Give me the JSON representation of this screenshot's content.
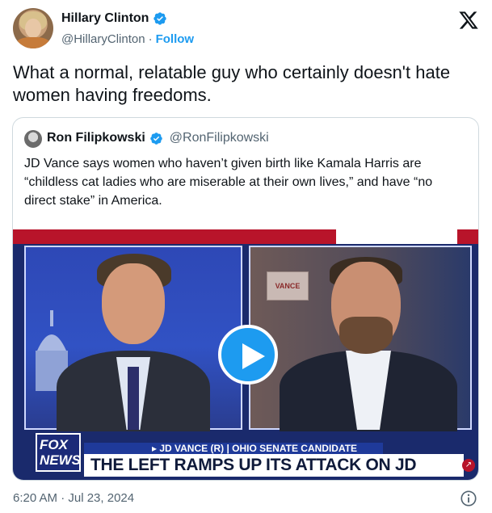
{
  "author": {
    "display_name": "Hillary Clinton",
    "handle": "@HillaryClinton",
    "separator": "·",
    "follow_label": "Follow",
    "verified_icon": "verified-badge-icon"
  },
  "brand_icon": "x-logo-icon",
  "tweet": {
    "text": "What a normal, relatable guy who certainly doesn't hate women having freedoms."
  },
  "quote": {
    "display_name": "Ron Filipkowski",
    "handle": "@RonFilipkowski",
    "text": "JD Vance says women who haven’t given birth like Kamala Harris are “childless cat ladies who are miserable at their own lives,” and have “no direct stake” in America.",
    "video": {
      "lower_third_top": "▸ JD VANCE (R) | OHIO SENATE CANDIDATE",
      "lower_third_main": "THE LEFT RAMPS UP ITS ATTACK ON JD VANCE",
      "logo_line1": "FOX",
      "logo_line2": "NEWS",
      "sign_text": "VANCE",
      "play_icon": "play-icon"
    }
  },
  "footer": {
    "timestamp": "6:20 AM · Jul 23, 2024",
    "info_icon": "info-icon"
  },
  "colors": {
    "accent": "#1d9bf0",
    "text_primary": "#0f1419",
    "text_secondary": "#536471",
    "border": "#cfd9de"
  }
}
